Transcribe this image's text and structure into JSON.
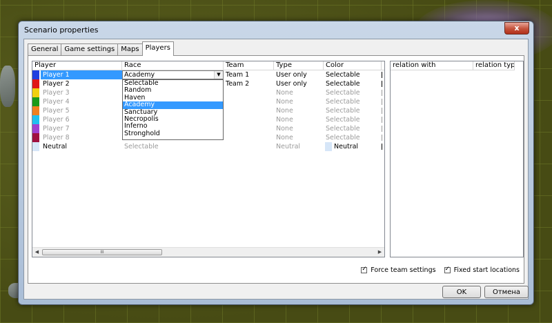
{
  "window": {
    "title": "Scenario properties",
    "close_label": "x"
  },
  "tabs": [
    {
      "label": "General",
      "active": false
    },
    {
      "label": "Game settings",
      "active": false
    },
    {
      "label": "Maps",
      "active": false
    },
    {
      "label": "Players",
      "active": true
    }
  ],
  "players_table": {
    "headers": [
      "Player",
      "Race",
      "Team",
      "Type",
      "Color"
    ],
    "rows": [
      {
        "color": "#1f3fe0",
        "player": "Player 1",
        "race": "",
        "team": "Team 1",
        "type": "User only",
        "color_label": "Selectable",
        "selected": true,
        "enabled": true
      },
      {
        "color": "#e01818",
        "player": "Player 2",
        "race": "",
        "team": "Team 2",
        "type": "User only",
        "color_label": "Selectable",
        "selected": false,
        "enabled": true
      },
      {
        "color": "#f0d010",
        "player": "Player 3",
        "race": "",
        "team": "",
        "type": "None",
        "color_label": "Selectable",
        "selected": false,
        "enabled": false
      },
      {
        "color": "#1a9a1a",
        "player": "Player 4",
        "race": "",
        "team": "",
        "type": "None",
        "color_label": "Selectable",
        "selected": false,
        "enabled": false
      },
      {
        "color": "#f08020",
        "player": "Player 5",
        "race": "",
        "team": "",
        "type": "None",
        "color_label": "Selectable",
        "selected": false,
        "enabled": false
      },
      {
        "color": "#20c0f0",
        "player": "Player 6",
        "race": "",
        "team": "",
        "type": "None",
        "color_label": "Selectable",
        "selected": false,
        "enabled": false
      },
      {
        "color": "#a040d0",
        "player": "Player 7",
        "race": "",
        "team": "",
        "type": "None",
        "color_label": "Selectable",
        "selected": false,
        "enabled": false
      },
      {
        "color": "#a01040",
        "player": "Player 8",
        "race": "",
        "team": "",
        "type": "None",
        "color_label": "Selectable",
        "selected": false,
        "enabled": false
      },
      {
        "color": "#d6e6f8",
        "player": "Neutral",
        "race": "Selectable",
        "team": "",
        "type": "Neutral",
        "color_label": "Neutral",
        "selected": false,
        "enabled": true,
        "neutral": true
      }
    ],
    "race_combo_value": "Academy",
    "race_options": [
      "Selectable",
      "Random",
      "Haven",
      "Academy",
      "Sanctuary",
      "Necropolis",
      "Inferno",
      "Stronghold"
    ],
    "race_highlighted": "Academy",
    "scroll_thumb_grip": "III"
  },
  "relations_table": {
    "headers": [
      "relation with",
      "relation type"
    ]
  },
  "options": {
    "force_team_label": "Force team settings",
    "force_team_checked": true,
    "fixed_start_label": "Fixed start locations",
    "fixed_start_checked": true
  },
  "buttons": {
    "ok": "OK",
    "cancel": "Отмена"
  }
}
